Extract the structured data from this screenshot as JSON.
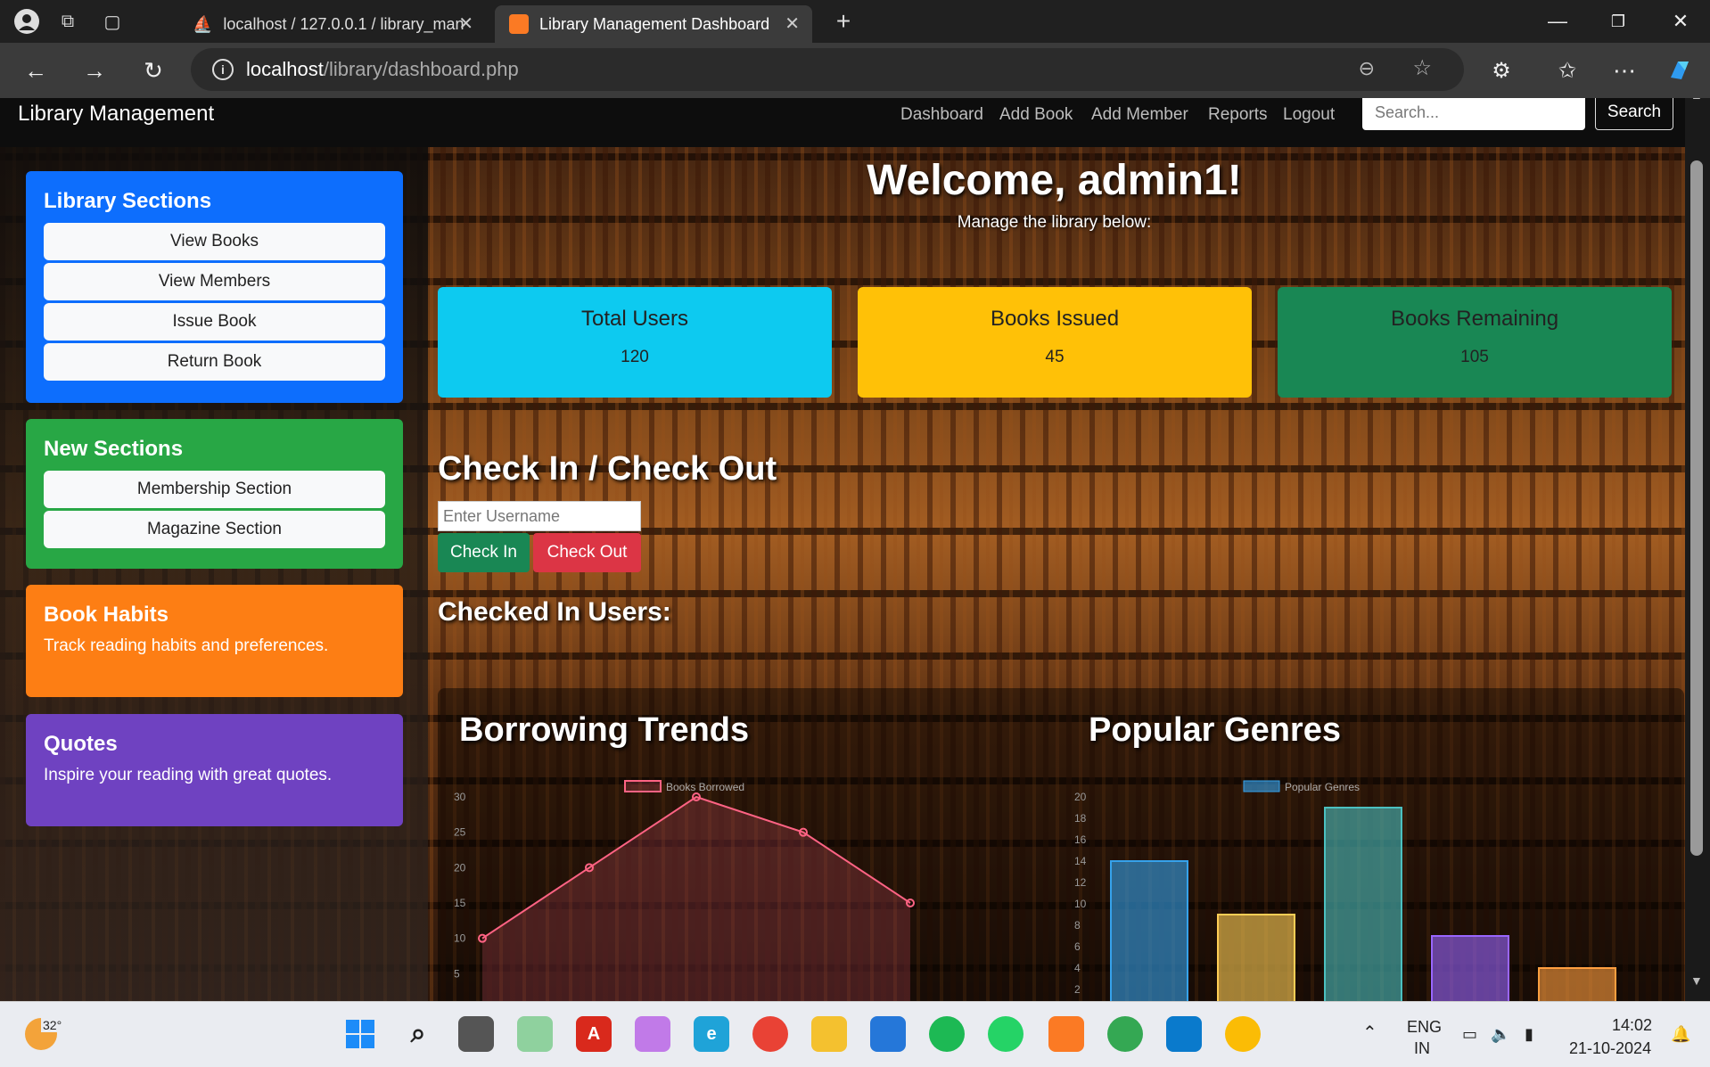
{
  "browser": {
    "tabs": [
      {
        "title": "localhost / 127.0.0.1 / library_man"
      },
      {
        "title": "Library Management Dashboard"
      }
    ],
    "url_host": "localhost",
    "url_path": "/library/dashboard.php"
  },
  "nav": {
    "brand": "Library Management",
    "links": [
      "Dashboard",
      "Add Book",
      "Add Member",
      "Reports",
      "Logout"
    ],
    "search_placeholder": "Search...",
    "search_button": "Search"
  },
  "sidebar": {
    "library_sections": {
      "title": "Library Sections",
      "items": [
        "View Books",
        "View Members",
        "Issue Book",
        "Return Book"
      ],
      "color": "#0d6efd"
    },
    "new_sections": {
      "title": "New Sections",
      "items": [
        "Membership Section",
        "Magazine Section"
      ],
      "color": "#28a745"
    },
    "book_habits": {
      "title": "Book Habits",
      "text": "Track reading habits and preferences.",
      "color": "#fd7e14"
    },
    "quotes": {
      "title": "Quotes",
      "text": "Inspire your reading with great quotes.",
      "color": "#6f42c1"
    }
  },
  "main": {
    "welcome": "Welcome, admin1!",
    "subtitle": "Manage the library below:",
    "stats": [
      {
        "title": "Total Users",
        "value": "120",
        "color": "#0dcaf0"
      },
      {
        "title": "Books Issued",
        "value": "45",
        "color": "#ffc107"
      },
      {
        "title": "Books Remaining",
        "value": "105",
        "color": "#198754"
      }
    ],
    "checkin": {
      "title": "Check In / Check Out",
      "placeholder": "Enter Username",
      "checkin_label": "Check In",
      "checkout_label": "Check Out",
      "checked_in_title": "Checked In Users:"
    }
  },
  "chart_data": [
    {
      "type": "line",
      "title": "Borrowing Trends",
      "series": [
        {
          "name": "Books Borrowed",
          "values": [
            10,
            20,
            30,
            25,
            15
          ]
        }
      ],
      "ylim": [
        0,
        30
      ],
      "yticks": [
        5,
        10,
        15,
        20,
        25,
        30
      ],
      "color": "#ff6384"
    },
    {
      "type": "bar",
      "title": "Popular Genres",
      "series": [
        {
          "name": "Popular Genres",
          "values": [
            14,
            9,
            19,
            7,
            4
          ]
        }
      ],
      "colors": [
        "#36a2eb",
        "#ffce56",
        "#4bc0c0",
        "#9966ff",
        "#ff9f40"
      ],
      "ylim": [
        0,
        20
      ],
      "yticks": [
        2,
        4,
        6,
        8,
        10,
        12,
        14,
        16,
        18,
        20
      ]
    }
  ],
  "taskbar": {
    "weather": "32°",
    "lang1": "ENG",
    "lang2": "IN",
    "time": "14:02",
    "date": "21-10-2024"
  }
}
